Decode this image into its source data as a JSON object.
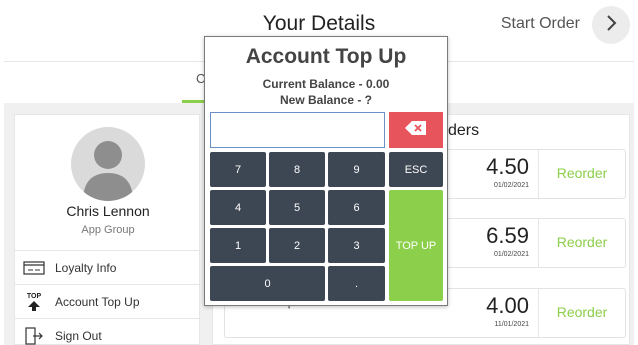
{
  "header": {
    "title": "Your Details",
    "start_order_label": "Start Order",
    "start_order_icon": "chevron-right-icon"
  },
  "tabs": {
    "partial_label": "C"
  },
  "profile": {
    "name": "Chris Lennon",
    "group": "App Group",
    "menu": [
      {
        "label": "Loyalty Info",
        "icon": "loyalty-card-icon"
      },
      {
        "label": "Account Top Up",
        "icon": "top-up-icon",
        "icon_text": "TOP"
      },
      {
        "label": "Sign Out",
        "icon": "sign-out-icon"
      }
    ]
  },
  "orders": {
    "title_partial": "ders",
    "reorder_label": "Reorder",
    "items": [
      {
        "name": "",
        "price": "4.50",
        "date": "01/02/2021"
      },
      {
        "name": "",
        "price": "6.59",
        "date": "01/02/2021"
      },
      {
        "name": "Bacon Cup",
        "price": "4.00",
        "date": "11/01/2021"
      }
    ]
  },
  "modal": {
    "title": "Account Top Up",
    "current_balance": "Current Balance - 0.00",
    "new_balance": "New Balance - ?",
    "input_value": "",
    "keys": {
      "k7": "7",
      "k8": "8",
      "k9": "9",
      "esc": "ESC",
      "k4": "4",
      "k5": "5",
      "k6": "6",
      "k1": "1",
      "k2": "2",
      "k3": "3",
      "k0": "0",
      "dot": ".",
      "top_up": "TOP UP"
    }
  },
  "colors": {
    "accent_green": "#8ccf4a",
    "key_dark": "#3d4653",
    "backspace_red": "#e8545c"
  }
}
